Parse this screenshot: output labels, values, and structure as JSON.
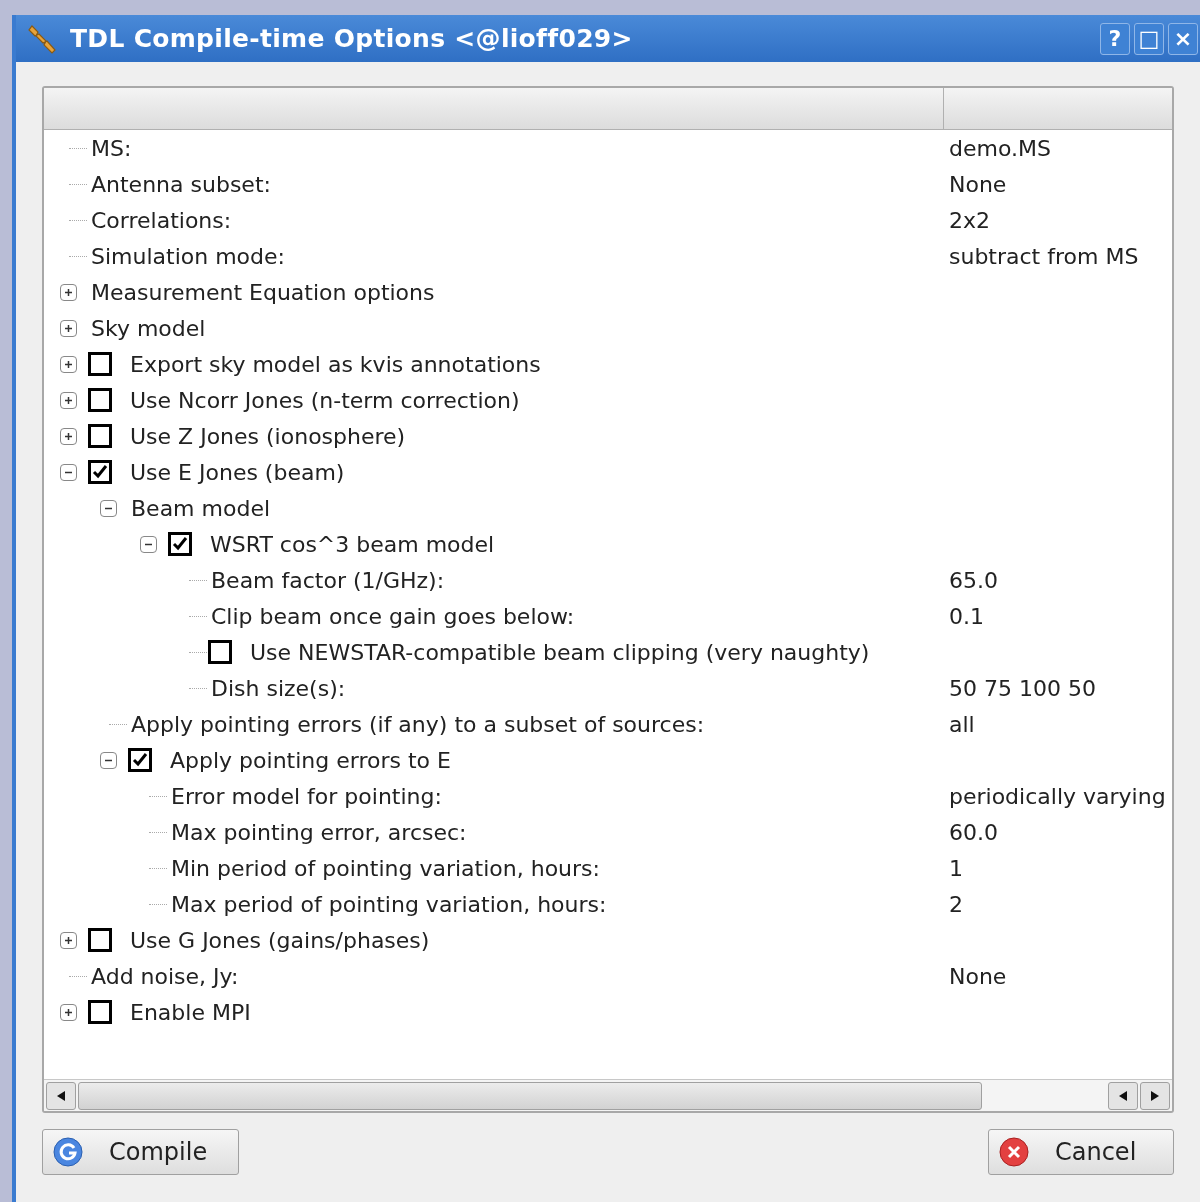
{
  "window": {
    "title": "TDL Compile-time Options <@lioff029>",
    "controls": [
      "?",
      "□",
      "×"
    ]
  },
  "tree": [
    {
      "label": "MS:",
      "value": "demo.MS"
    },
    {
      "label": "Antenna subset:",
      "value": "None"
    },
    {
      "label": "Correlations:",
      "value": "2x2"
    },
    {
      "label": "Simulation mode:",
      "value": "subtract from MS"
    },
    {
      "label": "Measurement Equation options",
      "expanded": false
    },
    {
      "label": "Sky model",
      "expanded": false
    },
    {
      "label": "Export sky model as kvis annotations",
      "checked": false,
      "expanded": false
    },
    {
      "label": "Use Ncorr Jones (n-term correction)",
      "checked": false,
      "expanded": false
    },
    {
      "label": "Use Z Jones (ionosphere)",
      "checked": false,
      "expanded": false
    },
    {
      "label": "Use E Jones (beam)",
      "checked": true,
      "expanded": true,
      "children": [
        {
          "label": "Beam model",
          "expanded": true,
          "children": [
            {
              "label": "WSRT cos^3 beam model",
              "checked": true,
              "expanded": true,
              "children": [
                {
                  "label": "Beam factor (1/GHz):",
                  "value": "65.0"
                },
                {
                  "label": "Clip beam once gain goes below:",
                  "value": "0.1"
                },
                {
                  "label": "Use NEWSTAR-compatible beam clipping (very naughty)",
                  "checked": false
                },
                {
                  "label": "Dish size(s):",
                  "value": "50 75 100 50"
                }
              ]
            }
          ]
        },
        {
          "label": "Apply pointing errors (if any) to a subset of sources:",
          "value": "all"
        },
        {
          "label": "Apply pointing errors to E",
          "checked": true,
          "expanded": true,
          "children": [
            {
              "label": "Error model for pointing:",
              "value": "periodically varying"
            },
            {
              "label": "Max pointing error, arcsec:",
              "value": "60.0"
            },
            {
              "label": "Min period of pointing variation, hours:",
              "value": "1"
            },
            {
              "label": "Max period of pointing variation, hours:",
              "value": "2"
            }
          ]
        }
      ]
    },
    {
      "label": "Use G Jones (gains/phases)",
      "checked": false,
      "expanded": false
    },
    {
      "label": "Add noise, Jy:",
      "value": "None"
    },
    {
      "label": "Enable MPI",
      "checked": false,
      "expanded": false
    }
  ],
  "buttons": [
    {
      "label": "Compile",
      "kind": "compile"
    },
    {
      "label": "Cancel",
      "kind": "cancel"
    }
  ]
}
